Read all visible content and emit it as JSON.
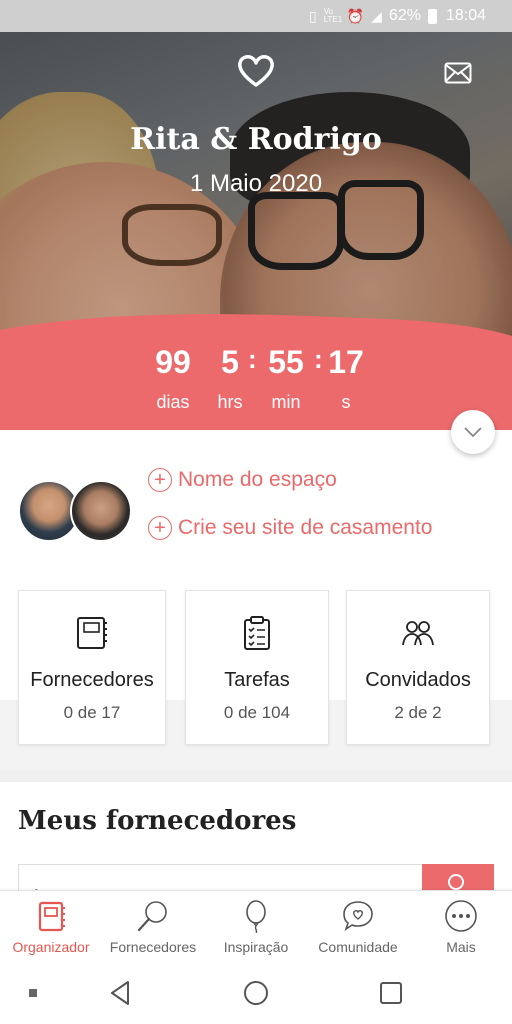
{
  "status_bar": {
    "battery": "62%",
    "time": "18:04",
    "vol": "Vo LTE1"
  },
  "hero": {
    "couple_names": "Rita & Rodrigo",
    "wedding_date": "1 Maio 2020",
    "countdown": {
      "days": "99",
      "days_label": "dias",
      "hours": "5",
      "hours_label": "hrs",
      "minutes": "55",
      "minutes_label": "min",
      "seconds": "17",
      "seconds_label": "s"
    }
  },
  "profile": {
    "space_name_link": "Nome do espaço",
    "create_site_link": "Crie seu site de casamento"
  },
  "cards": [
    {
      "title": "Fornecedores",
      "count": "0 de 17",
      "icon": "notebook-icon"
    },
    {
      "title": "Tarefas",
      "count": "0 de 104",
      "icon": "clipboard-checklist-icon"
    },
    {
      "title": "Convidados",
      "count": "2 de 2",
      "icon": "guests-icon"
    }
  ],
  "vendors_section": {
    "title": "Meus fornecedores"
  },
  "bottom_nav": [
    {
      "label": "Organizador",
      "icon": "organizer-icon",
      "active": true
    },
    {
      "label": "Fornecedores",
      "icon": "search-vendors-icon",
      "active": false
    },
    {
      "label": "Inspiração",
      "icon": "balloon-icon",
      "active": false
    },
    {
      "label": "Comunidade",
      "icon": "chat-heart-icon",
      "active": false
    },
    {
      "label": "Mais",
      "icon": "more-icon",
      "active": false
    }
  ],
  "colors": {
    "accent": "#ec6a6c",
    "active_nav": "#e5574f",
    "link": "#e86a6a"
  }
}
